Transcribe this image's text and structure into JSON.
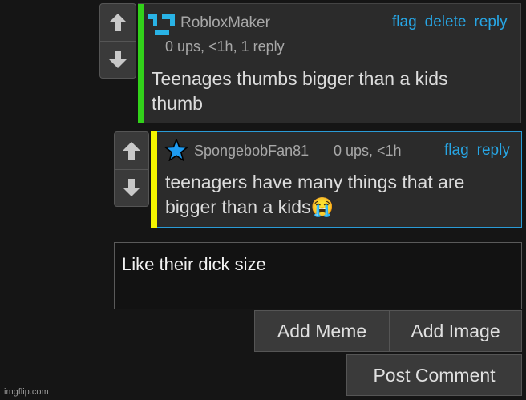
{
  "comment1": {
    "username": "RobloxMaker",
    "meta": "0 ups, <1h, 1 reply",
    "actions": [
      "flag",
      "delete",
      "reply"
    ],
    "text_line1": "Teenages thumbs bigger than a kids",
    "text_line2": "thumb",
    "stripe_color": "#32d11a",
    "avatar_icon": "robloxmaker-avatar-icon"
  },
  "comment2": {
    "username": "SpongebobFan81",
    "meta": "0 ups, <1h",
    "actions": [
      "flag",
      "reply"
    ],
    "text_line1": "teenagers have many things that are",
    "text_line2": "bigger than a kids😭",
    "stripe_color": "#f4f400",
    "avatar_icon": "blue-star-icon"
  },
  "reply_input": {
    "value": "Like their dick size"
  },
  "buttons": {
    "add_meme": "Add Meme",
    "add_image": "Add Image",
    "post_comment": "Post Comment"
  },
  "watermark": "imgflip.com",
  "accent_color": "#27a6e5"
}
